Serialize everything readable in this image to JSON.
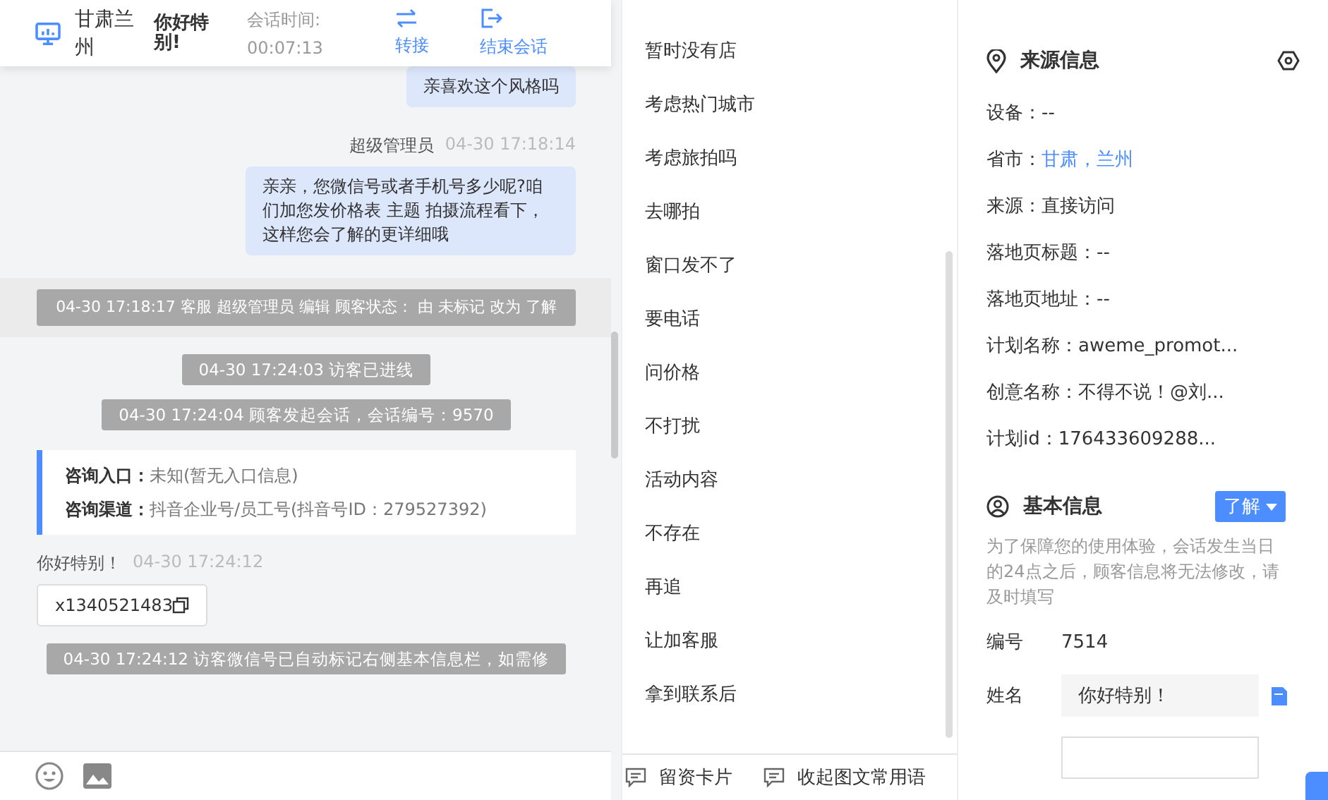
{
  "header": {
    "location": "甘肃兰州",
    "visitor_name": "你好特别!",
    "session_time_label": "会话时间:",
    "session_time": "00:07:13",
    "actions": [
      {
        "label": "转接",
        "kind": "transfer"
      },
      {
        "label": "结束会话",
        "kind": "end"
      }
    ]
  },
  "messages": [
    {
      "kind": "agent",
      "text": "亲喜欢这个风格吗"
    },
    {
      "kind": "agent",
      "sender": "超级管理员",
      "time": "04-30 17:18:14",
      "text": "亲亲，您微信号或者手机号多少呢?咱们加您发价格表 主题 拍摄流程看下，这样您会了解的更详细哦"
    },
    {
      "kind": "system",
      "highlighted": true,
      "text": "04-30 17:18:17 客服 超级管理员 编辑 顾客状态： 由 未标记 改为 了解"
    },
    {
      "kind": "system",
      "highlighted": false,
      "text": "04-30 17:24:03 访客已进线"
    },
    {
      "kind": "system",
      "highlighted": false,
      "text": "04-30 17:24:04 顾客发起会话，会话编号：9570"
    },
    {
      "kind": "entry",
      "rows": [
        {
          "label": "咨询入口：",
          "value": "未知(暂无入口信息)"
        },
        {
          "label": "咨询渠道：",
          "value": "抖音企业号/员工号(抖音号ID：279527392)"
        }
      ]
    },
    {
      "kind": "visitor",
      "sender": "你好特别！",
      "time": "04-30 17:24:12",
      "text": "x1340521483"
    },
    {
      "kind": "system",
      "highlighted": false,
      "text": "04-30 17:24:12 访客微信号已自动标记右侧基本信息栏，如需修"
    }
  ],
  "quick_replies": [
    "暂时没有店",
    "考虑热门城市",
    "考虑旅拍吗",
    "去哪拍",
    "窗口发不了",
    "要电话",
    "问价格",
    "不打扰",
    "活动内容",
    "不存在",
    "再追",
    "让加客服",
    "拿到联系后"
  ],
  "quick_footer": [
    {
      "label": "留资卡片"
    },
    {
      "label": "收起图文常用语"
    }
  ],
  "source_info": {
    "title": "来源信息",
    "rows": [
      {
        "kind": "text",
        "text": "设备：--"
      },
      {
        "kind": "link",
        "label": "省市：",
        "value": "甘肃，兰州"
      },
      {
        "kind": "text",
        "text": "来源：直接访问"
      },
      {
        "kind": "text",
        "text": "落地页标题：--"
      },
      {
        "kind": "text",
        "text": "落地页地址：--"
      },
      {
        "kind": "text",
        "text": "计划名称：aweme_promot..."
      },
      {
        "kind": "text",
        "text": "创意名称：不得不说！@刘..."
      },
      {
        "kind": "text",
        "text": "计划id：176433609288..."
      }
    ]
  },
  "basic_info": {
    "title": "基本信息",
    "status": "了解",
    "notice": "为了保障您的使用体验，会话发生当日的24点之后，顾客信息将无法修改，请及时填写",
    "fields": [
      {
        "kind": "text",
        "label": "编号",
        "value": "7514"
      },
      {
        "kind": "input",
        "label": "姓名",
        "value": "你好特别！"
      }
    ]
  }
}
